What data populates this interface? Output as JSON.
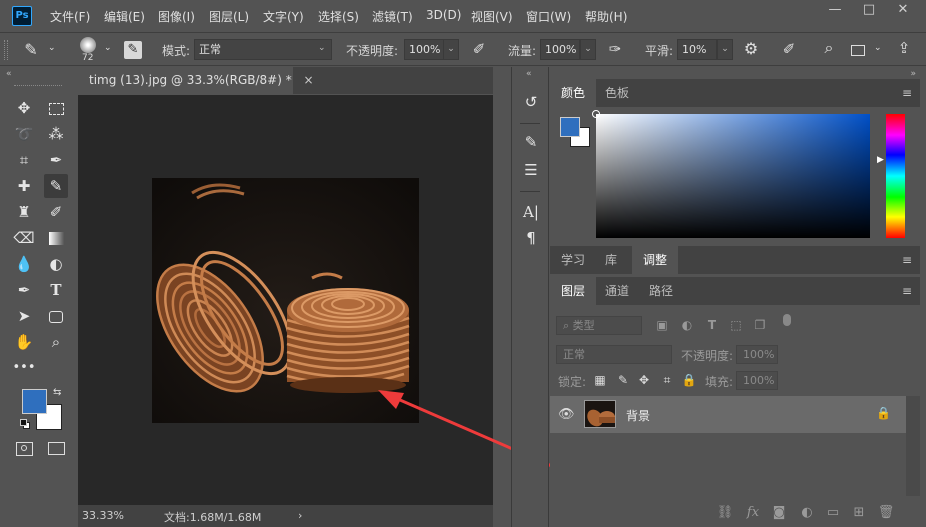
{
  "app": {
    "logo_text": "Ps",
    "menus": [
      "文件(F)",
      "编辑(E)",
      "图像(I)",
      "图层(L)",
      "文字(Y)",
      "选择(S)",
      "滤镜(T)",
      "3D(D)",
      "视图(V)",
      "窗口(W)",
      "帮助(H)"
    ],
    "window_buttons": {
      "minimize": "—",
      "maximize": "□",
      "close": "✕"
    }
  },
  "options_bar": {
    "brush_size": "72",
    "mode_label": "模式:",
    "mode_value": "正常",
    "opacity_label": "不透明度:",
    "opacity_value": "100%",
    "flow_label": "流量:",
    "flow_value": "100%",
    "smoothing_label": "平滑:",
    "smoothing_value": "10%"
  },
  "document": {
    "tab_title": "timg (13).jpg @ 33.3%(RGB/8#) *",
    "tab_close": "×",
    "zoom": "33.33%",
    "doc_info": "文档:1.68M/1.68M",
    "status_arrow": "›"
  },
  "color_panel": {
    "tabs": [
      "颜色",
      "色板"
    ],
    "foreground": "#2f6fbe",
    "background": "#ffffff",
    "field_hue": "#0050c8"
  },
  "adjust_panel": {
    "tabs": [
      "学习",
      "库",
      "调整"
    ]
  },
  "layers_panel": {
    "tabs": [
      "图层",
      "通道",
      "路径"
    ],
    "filter_label": "类型",
    "blend_mode": "正常",
    "opacity_label": "不透明度:",
    "opacity_value": "100%",
    "lock_label": "锁定:",
    "fill_label": "填充:",
    "fill_value": "100%",
    "layers": [
      {
        "name": "背景",
        "visible": true,
        "locked": true
      }
    ]
  },
  "colors": {
    "arrow": "#ee3b3b",
    "accent": "#31a8ff"
  }
}
